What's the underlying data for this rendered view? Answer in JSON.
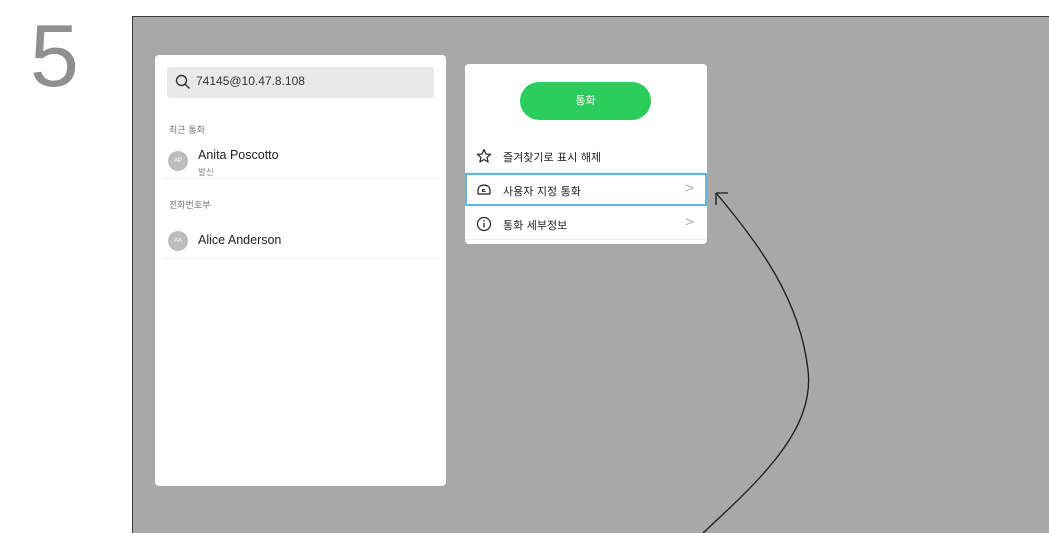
{
  "step": {
    "number": "5"
  },
  "directory": {
    "search_value": "74145@10.47.8.108",
    "recent_label": "최근 통화",
    "recent": [
      {
        "initials": "AP",
        "name": "Anita Poscotto",
        "detail": "발신"
      }
    ],
    "phonebook_label": "전화번호부",
    "phonebook": [
      {
        "initials": "AA",
        "name": "Alice Anderson"
      }
    ]
  },
  "menu": {
    "call_label": "통화",
    "items": [
      {
        "label": "즐겨찾기로 표시 해제",
        "icon": "star-icon"
      },
      {
        "label": "사용자 지정 통화",
        "icon": "custom-call-icon",
        "chevron": ">",
        "highlighted": true
      },
      {
        "label": "통화 세부정보",
        "icon": "info-icon",
        "chevron": ">"
      }
    ]
  },
  "colors": {
    "screen_bg": "#a8a8a8",
    "call_green": "#2bcd5c",
    "highlight": "#5ab8e2"
  }
}
